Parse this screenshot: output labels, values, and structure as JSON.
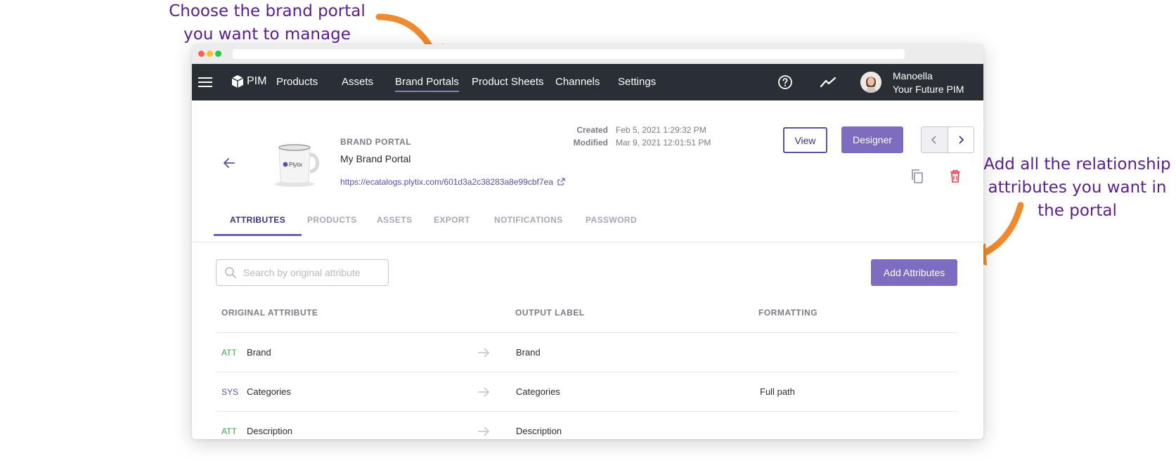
{
  "annotations": {
    "top": [
      "Choose the brand portal",
      "you want to manage"
    ],
    "right": [
      "Add all the relationship",
      "attributes you want in",
      "the portal"
    ]
  },
  "nav": {
    "brand": "PIM",
    "items": [
      "Products",
      "Assets",
      "Brand Portals",
      "Product Sheets",
      "Channels",
      "Settings"
    ],
    "active": "Brand Portals",
    "user_name": "Manoella",
    "user_org": "Your Future PIM"
  },
  "portal": {
    "kicker": "BRAND PORTAL",
    "name": "My Brand Portal",
    "url": "https://ecatalogs.plytix.com/601d3a2c38283a8e99cbf7ea",
    "mug_logo_text": "Plytix",
    "created_label": "Created",
    "created_value": "Feb 5, 2021 1:29:32 PM",
    "modified_label": "Modified",
    "modified_value": "Mar 9, 2021 12:01:51 PM",
    "view_label": "View",
    "designer_label": "Designer"
  },
  "tabs": [
    "ATTRIBUTES",
    "PRODUCTS",
    "ASSETS",
    "EXPORT",
    "NOTIFICATIONS",
    "PASSWORD"
  ],
  "active_tab": "ATTRIBUTES",
  "search": {
    "placeholder": "Search by original attribute",
    "value": ""
  },
  "add_button_label": "Add Attributes",
  "table": {
    "headers": [
      "ORIGINAL ATTRIBUTE",
      "OUTPUT LABEL",
      "FORMATTING"
    ],
    "rows": [
      {
        "type": "ATT",
        "original": "Brand",
        "output": "Brand",
        "formatting": ""
      },
      {
        "type": "SYS",
        "original": "Categories",
        "output": "Categories",
        "formatting": "Full path"
      },
      {
        "type": "ATT",
        "original": "Description",
        "output": "Description",
        "formatting": ""
      }
    ]
  },
  "colors": {
    "accent": "#7d6cbf",
    "nav_bg": "#2a2f36",
    "annotation_text": "#5a1f8a",
    "annotation_arrow": "#f08a2c",
    "type_att": "#3fa04a",
    "type_sys": "#5e4fa2",
    "delete": "#e23b4e"
  },
  "icons": {
    "menu": "hamburger-icon",
    "brand": "cube-icon",
    "help": "help-circle-icon",
    "analytics": "trend-icon",
    "back": "arrow-left-icon",
    "external": "external-link-icon",
    "prev": "chevron-left-icon",
    "next": "chevron-right-icon",
    "duplicate": "copy-icon",
    "delete": "trash-icon",
    "search": "search-icon",
    "mapping": "arrow-right-icon"
  }
}
